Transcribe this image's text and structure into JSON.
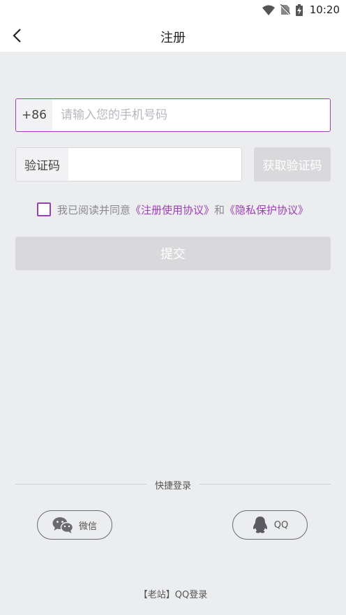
{
  "status_bar": {
    "time": "10:20",
    "icons": [
      "wifi-icon",
      "no-sim-icon",
      "battery-charging-icon"
    ]
  },
  "header": {
    "title": "注册",
    "back_icon": "chevron-left-icon"
  },
  "phone": {
    "prefix": "+86",
    "placeholder": "请输入您的手机号码",
    "value": ""
  },
  "verification": {
    "label": "验证码",
    "value": "",
    "get_code_label": "获取验证码"
  },
  "agreement": {
    "prefix": "我已阅读并同意",
    "terms_link": "《注册使用协议》",
    "connector": "和",
    "privacy_link": "《隐私保护协议》",
    "checked": false
  },
  "submit_label": "提交",
  "quick_login": {
    "label": "快捷登录",
    "wechat_label": "微信",
    "qq_label": "QQ"
  },
  "old_site_login": "【老站】QQ登录",
  "colors": {
    "accent": "#9b3fb5",
    "background": "#ecedef",
    "disabled": "#d9d9dc"
  }
}
